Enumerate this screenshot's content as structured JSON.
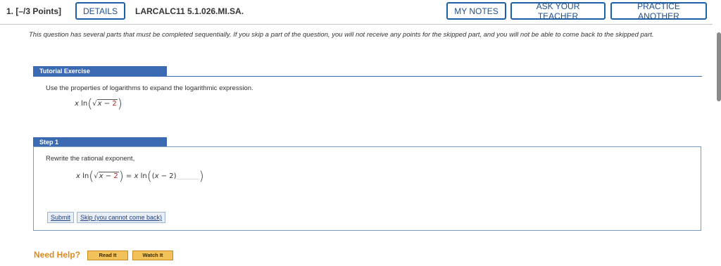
{
  "header": {
    "question_number": "1.",
    "points": "[–/3 Points]",
    "details_label": "DETAILS",
    "question_code": "LARCALC11 5.1.026.MI.SA.",
    "my_notes_label": "MY NOTES",
    "ask_teacher_label": "ASK YOUR TEACHER",
    "practice_another_label": "PRACTICE ANOTHER"
  },
  "intro": "This question has several parts that must be completed sequentially. If you skip a part of the question, you will not receive any points for the skipped part, and you will not be able to come back to the skipped part.",
  "tutorial": {
    "tab_label": "Tutorial Exercise",
    "prompt": "Use the properties of logarithms to expand the logarithmic expression.",
    "expr": {
      "coef": "x",
      "func": "ln",
      "radicand_var": "x",
      "radicand_rest": " − ",
      "radicand_num": "2"
    }
  },
  "step": {
    "tab_label": "Step 1",
    "instruction": "Rewrite the rational exponent,",
    "lhs": {
      "coef": "x",
      "func": "ln",
      "radicand_var": "x",
      "radicand_rest": " − ",
      "radicand_num": "2"
    },
    "equals": " = ",
    "rhs": {
      "coef": "x",
      "func": "ln",
      "inner_var": "x",
      "inner_rest": " − 2)"
    },
    "submit_label": "Submit",
    "skip_label": "Skip (you cannot come back)"
  },
  "help": {
    "label": "Need Help?",
    "read_it_label": "Read It",
    "watch_it_label": "Watch It"
  },
  "colors": {
    "accent": "#3b6ab3",
    "button_border": "#1f5fa8",
    "help": "#e08a1e"
  }
}
